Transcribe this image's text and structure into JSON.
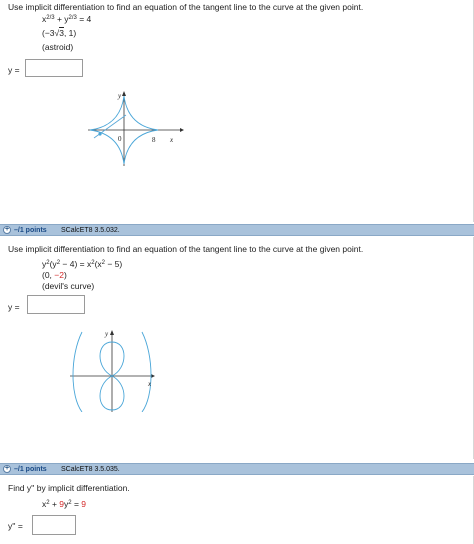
{
  "problem1": {
    "instruction": "Use implicit differentiation to find an equation of the tangent line to the curve at the given point.",
    "equation": {
      "t1": "x",
      "e1": "2/3",
      "t2": " + y",
      "e2": "2/3",
      "t3": " = 4"
    },
    "point": {
      "pre": "(−3",
      "radical": "3",
      "post": ", 1)"
    },
    "curve_name": "(astroid)",
    "answer_label": "y =",
    "answer_value": "",
    "graph": {
      "y_label": "y",
      "x_label": "x",
      "origin_label": "0",
      "tick_label": "8"
    }
  },
  "problem2": {
    "bar": {
      "points": "–/1 points",
      "ref": "SCalcET8 3.5.032."
    },
    "instruction": "Use implicit differentiation to find an equation of the tangent line to the curve at the given point.",
    "equation": {
      "t1": "y",
      "e1": "2",
      "t2": "(y",
      "e2": "2",
      "t3": " − 4) = x",
      "e3": "2",
      "t4": "(x",
      "e4": "2",
      "t5": " − 5)"
    },
    "point": {
      "pre": "(0, ",
      "val": "−2",
      "post": ")"
    },
    "curve_name": "(devil's curve)",
    "answer_label": "y =",
    "answer_value": "",
    "graph": {
      "y_label": "y",
      "x_label": "x"
    }
  },
  "problem3": {
    "bar": {
      "points": "–/1 points",
      "ref": "SCalcET8 3.5.035."
    },
    "instruction": "Find y'' by implicit differentiation.",
    "equation": {
      "t1": "x",
      "e1": "2",
      "t2": " + ",
      "coef": "9",
      "t3": "y",
      "e3": "2",
      "t4": " = ",
      "rhs": "9"
    },
    "answer_label": "y'' =",
    "answer_value": ""
  },
  "colors": {
    "curve": "#4aa6d8",
    "tangent": "#5aa8d8",
    "bar": "#a9c2db",
    "highlight": "#d42a2a"
  }
}
